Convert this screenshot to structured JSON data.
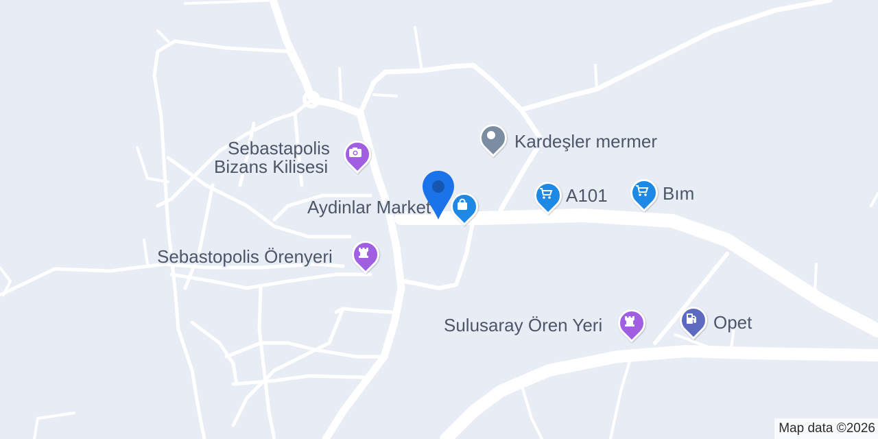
{
  "map": {
    "places": [
      {
        "id": "kardesler",
        "label": "Kardeşler mermer",
        "category": "generic-place",
        "icon": "place-dot-icon",
        "color": "#7b8ea1"
      },
      {
        "id": "sebastapolis-kilise",
        "label_lines": [
          "Sebastapolis",
          "Bizans Kilisesi"
        ],
        "category": "tourist-attraction",
        "icon": "camera-icon",
        "color": "#a05fe0"
      },
      {
        "id": "aydinlar",
        "label": "Aydinlar Market",
        "category": "shopping",
        "icon": "shopping-bag-icon",
        "color": "#1e88e5"
      },
      {
        "id": "a101",
        "label": "A101",
        "category": "grocery",
        "icon": "shopping-cart-icon",
        "color": "#1e88e5"
      },
      {
        "id": "bim",
        "label": "Bım",
        "category": "grocery",
        "icon": "shopping-cart-icon",
        "color": "#1e88e5"
      },
      {
        "id": "sebastopolis-orenyeri",
        "label": "Sebastopolis Örenyeri",
        "category": "historic-site",
        "icon": "castle-icon",
        "color": "#a05fe0"
      },
      {
        "id": "sulusaray",
        "label": "Sulusaray Ören Yeri",
        "category": "historic-site",
        "icon": "castle-icon",
        "color": "#a05fe0"
      },
      {
        "id": "opet",
        "label": "Opet",
        "category": "gas-station",
        "icon": "fuel-pump-icon",
        "color": "#5c6bc0"
      }
    ],
    "selected_marker": {
      "icon": "location-marker-icon",
      "color": "#1a73e8"
    },
    "attribution": "Map data ©2026"
  }
}
